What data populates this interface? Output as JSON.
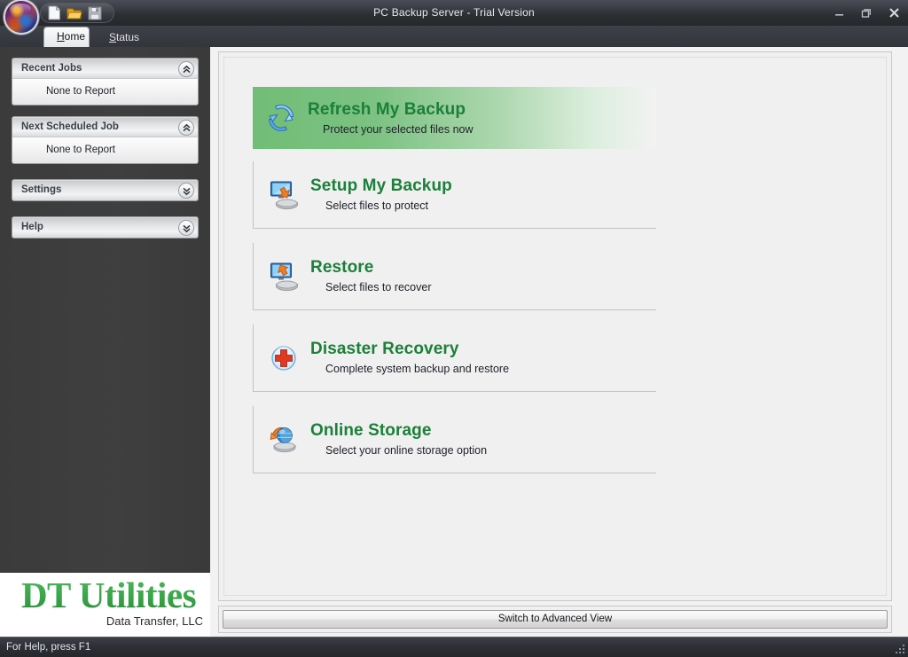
{
  "window": {
    "title": "PC Backup Server - Trial Version",
    "controls": [
      {
        "name": "minimize-button",
        "label": "–"
      },
      {
        "name": "restore-button",
        "label": "❐"
      },
      {
        "name": "close-button",
        "label": "✕"
      }
    ]
  },
  "toolbar": {
    "icons": [
      {
        "name": "new-document-icon",
        "label": "New"
      },
      {
        "name": "open-folder-icon",
        "label": "Open"
      },
      {
        "name": "save-icon",
        "label": "Save"
      }
    ]
  },
  "tabs": [
    {
      "label": "Home",
      "accel": "H",
      "active": true
    },
    {
      "label": "Status",
      "accel": "S",
      "active": false
    }
  ],
  "help_menu": {
    "label": "Help",
    "chevron": "ˇ"
  },
  "sidebar": {
    "panels": [
      {
        "title": "Recent Jobs",
        "body": "None to Report",
        "expanded": true,
        "toggle_icon": "double-chevron-up-icon"
      },
      {
        "title": "Next Scheduled Job",
        "body": "None to Report",
        "expanded": true,
        "toggle_icon": "double-chevron-up-icon"
      },
      {
        "title": "Settings",
        "body": "",
        "expanded": false,
        "toggle_icon": "double-chevron-down-icon"
      },
      {
        "title": "Help",
        "body": "",
        "expanded": false,
        "toggle_icon": "double-chevron-down-icon"
      }
    ],
    "brand": {
      "name": "DT Utilities",
      "tagline": "Data Transfer, LLC"
    }
  },
  "main": {
    "items": [
      {
        "title": "Refresh My Backup",
        "subtitle": "Protect your selected files now",
        "icon": "refresh-arrows-icon",
        "highlighted": true
      },
      {
        "title": "Setup My Backup",
        "subtitle": "Select files to protect",
        "icon": "monitor-to-drive-icon",
        "highlighted": false
      },
      {
        "title": "Restore",
        "subtitle": "Select files to recover",
        "icon": "drive-to-monitor-icon",
        "highlighted": false
      },
      {
        "title": "Disaster Recovery",
        "subtitle": "Complete system backup and restore",
        "icon": "red-cross-icon",
        "highlighted": false
      },
      {
        "title": "Online Storage",
        "subtitle": "Select your online storage option",
        "icon": "globe-drive-icon",
        "highlighted": false
      }
    ],
    "advanced_view_button": "Switch to Advanced View"
  },
  "statusbar": {
    "text": "For Help, press F1"
  },
  "colors": {
    "accent_green": "#1b8039",
    "highlight_green": "#71bd77",
    "titlebar_dark": "#3c3f46",
    "sidebar_dark": "#3b3b3b",
    "content_bg": "#f0f0f0"
  }
}
